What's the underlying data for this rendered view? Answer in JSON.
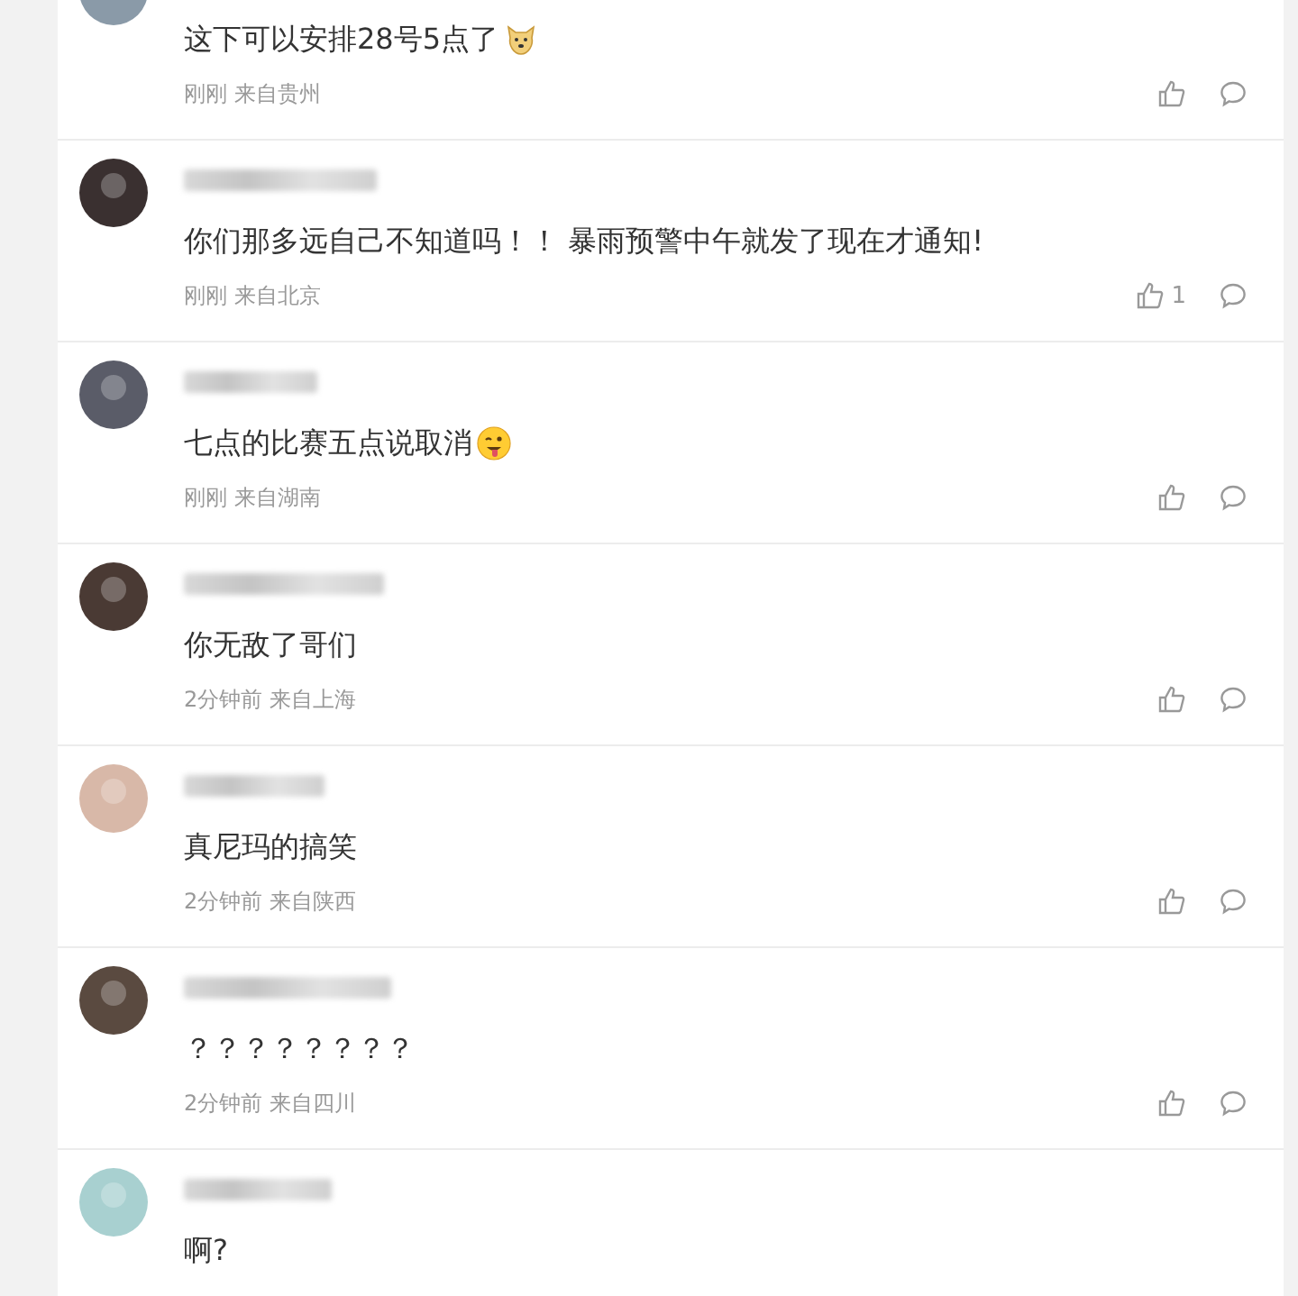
{
  "comments": [
    {
      "kind": "dog-emoji",
      "text": "这下可以安排28号5点了",
      "meta": "刚刚 来自贵州"
    },
    {
      "kind": "plain",
      "text": "你们那多远自己不知道吗！！ 暴雨预警中午就发了现在才通知!",
      "meta": "刚刚 来自北京",
      "likes": "1"
    },
    {
      "kind": "tongue-emoji",
      "text": "七点的比赛五点说取消",
      "meta": "刚刚 来自湖南"
    },
    {
      "kind": "plain",
      "text": "你无敌了哥们",
      "meta": "2分钟前 来自上海"
    },
    {
      "kind": "plain",
      "text": "真尼玛的搞笑",
      "meta": "2分钟前 来自陕西"
    },
    {
      "kind": "plain",
      "text": "？？？？？？？？",
      "meta": "2分钟前 来自四川"
    },
    {
      "kind": "plain",
      "text": "啊?"
    }
  ]
}
